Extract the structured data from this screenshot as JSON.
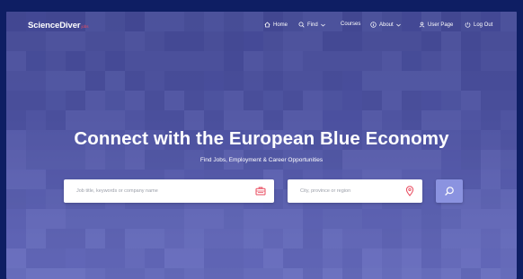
{
  "header": {
    "logo_main": "ScienceDiver",
    "logo_sub": "jobs"
  },
  "nav": {
    "home": "Home",
    "find": "Find",
    "courses": "Courses",
    "about": "About",
    "user_page": "User Page",
    "log_out": "Log Out"
  },
  "hero": {
    "title": "Connect with the European Blue Economy",
    "subtitle": "Find Jobs, Employment & Career Opportunities"
  },
  "search": {
    "keyword_placeholder": "Job title, keywords or company name",
    "location_placeholder": "City, province or region"
  },
  "colors": {
    "accent_red": "#e94b5f",
    "button": "#8b93e0",
    "page_bg": "#0e1e63"
  }
}
